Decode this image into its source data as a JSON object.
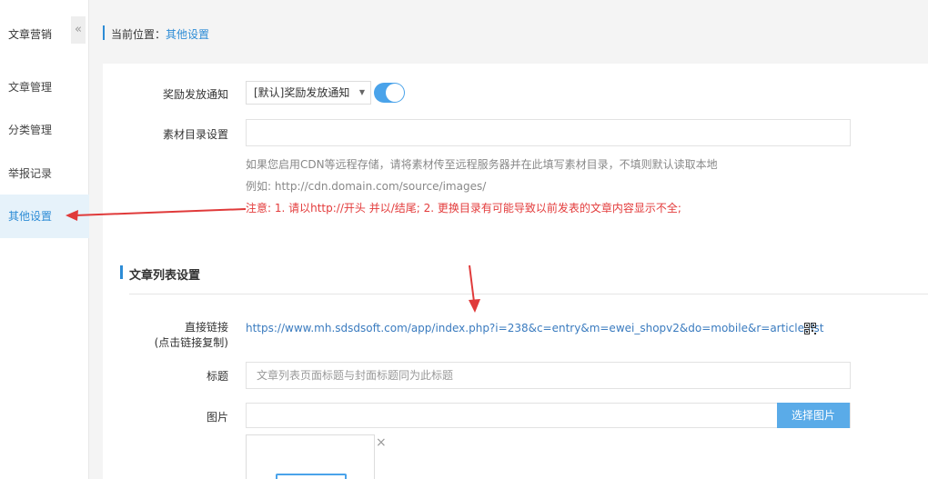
{
  "sidebar": {
    "title": "文章营销",
    "collapse_glyph": "«",
    "items": [
      {
        "label": "文章管理"
      },
      {
        "label": "分类管理"
      },
      {
        "label": "举报记录"
      },
      {
        "label": "其他设置"
      }
    ]
  },
  "breadcrumb": {
    "prefix": "当前位置：",
    "current": "其他设置"
  },
  "form": {
    "reward_notice": {
      "label": "奖励发放通知",
      "selected": "[默认]奖励发放通知",
      "toggle_on": true
    },
    "material_dir": {
      "label": "素材目录设置",
      "value": "",
      "help1": "如果您启用CDN等远程存储，请将素材传至远程服务器并在此填写素材目录，不填则默认读取本地",
      "help2": "例如: http://cdn.domain.com/source/images/",
      "warning": "注意: 1. 请以http://开头 并以/结尾; 2. 更换目录有可能导致以前发表的文章内容显示不全;"
    }
  },
  "list_section": {
    "title": "文章列表设置",
    "direct_link": {
      "label": "直接链接",
      "sublabel": "(点击链接复制)",
      "url": "https://www.mh.sdsdsoft.com/app/index.php?i=238&c=entry&m=ewei_shopv2&do=mobile&r=article.list",
      "icon": "qrcode-icon"
    },
    "title_field": {
      "label": "标题",
      "placeholder": "文章列表页面标题与封面标题同为此标题"
    },
    "image_field": {
      "label": "图片",
      "button": "选择图片",
      "remove_glyph": "×"
    }
  },
  "colors": {
    "accent": "#2d8cd6",
    "warning": "#e33b3b",
    "annotation_arrow": "#e03a3a"
  }
}
